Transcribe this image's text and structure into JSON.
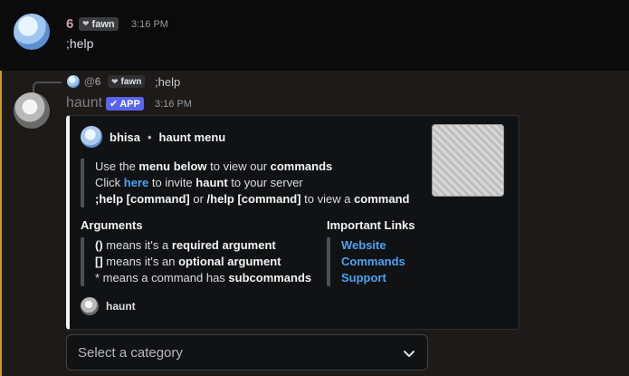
{
  "message1": {
    "username": "6",
    "username_color": "#c9a3a1",
    "badge": "fawn",
    "badge_icon": "heart-icon",
    "timestamp": "3:16 PM",
    "text": ";help"
  },
  "message2": {
    "reply": {
      "mention": "@6",
      "badge": "fawn",
      "text": ";help"
    },
    "username": "haunt",
    "app_badge": "APP",
    "timestamp": "3:16 PM",
    "embed": {
      "author": "bhisa",
      "separator": "•",
      "title": "haunt menu",
      "description": {
        "line1": {
          "pre": "Use the ",
          "b1": "menu below",
          "mid": " to view our ",
          "b2": "commands"
        },
        "line2": {
          "pre": "Click ",
          "link": "here",
          "mid": " to invite ",
          "b": "haunt",
          "post": " to your server"
        },
        "line3": {
          "b1": ";help [command]",
          "mid": " or ",
          "b2": "/help [command]",
          "mid2": " to view a ",
          "b3": "command"
        }
      },
      "arguments": {
        "name": "Arguments",
        "line1": {
          "b": "()",
          "mid": " means it's a ",
          "b2": "required argument"
        },
        "line2": {
          "b": "[]",
          "mid": " means it's an ",
          "b2": "optional argument"
        },
        "line3": {
          "pre": "* means a command has ",
          "b": "subcommands"
        }
      },
      "links": {
        "name": "Important Links",
        "items": [
          "Website",
          "Commands",
          "Support"
        ]
      },
      "footer": "haunt",
      "accent_color": "#f2f3f5",
      "link_color": "#4aa3f2"
    }
  },
  "select": {
    "placeholder": "Select a category",
    "icon": "chevron-down-icon"
  }
}
